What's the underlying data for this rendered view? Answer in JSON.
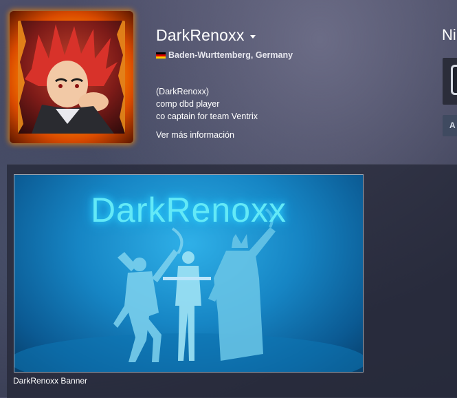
{
  "profile": {
    "persona_name": "DarkRenoxx",
    "location": "Baden-Wurttemberg, Germany",
    "flag_icon": "germany-flag-icon",
    "summary_lines": [
      "(DarkRenoxx)",
      "comp dbd player",
      "co captain for team Ventrix"
    ],
    "more_info_link": "Ver más información",
    "avatar_frame_color": "#ff8a00"
  },
  "level": {
    "label": "Ni",
    "action_button_label": "A"
  },
  "showcase": {
    "artwork_title_text": "DarkRenoxx",
    "artwork_caption": "DarkRenoxx Banner",
    "artwork_accent": "#63e9f7"
  }
}
